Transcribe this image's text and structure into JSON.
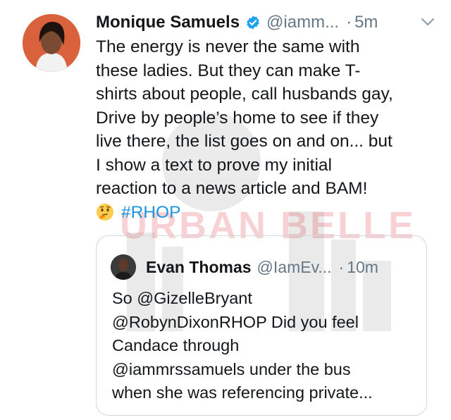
{
  "tweet": {
    "author_name": "Monique Samuels",
    "handle": "@iamm...",
    "separator": "·",
    "time": "5m",
    "lines": [
      "The energy is never the same with",
      "these ladies. But they can make T-",
      "shirts about people, call husbands gay,",
      "Drive by people’s home to see if they",
      "live there, the list goes on and on... but",
      "I show a text to prove my initial",
      "reaction to a news article and BAM!"
    ],
    "emoji": "thinking-face",
    "hashtag": "#RHOP"
  },
  "quoted_tweet": {
    "author_name": "Evan Thomas",
    "handle": "@IamEv...",
    "separator": "·",
    "time": "10m",
    "lines": [
      "So @GizelleBryant",
      "@RobynDixonRHOP  Did you feel",
      "Candace through",
      "@iammrssamuels under the bus",
      "when she was referencing private..."
    ]
  },
  "watermark": {
    "text": "URBAN BELLE",
    "color": "#e3343f"
  },
  "colors": {
    "text": "#14171a",
    "secondary": "#657786",
    "link": "#1b95e0",
    "verified": "#1da1f2",
    "border": "#cfd9de"
  },
  "icons": {
    "verified": "verified-badge-icon",
    "caret": "chevron-down-icon"
  }
}
